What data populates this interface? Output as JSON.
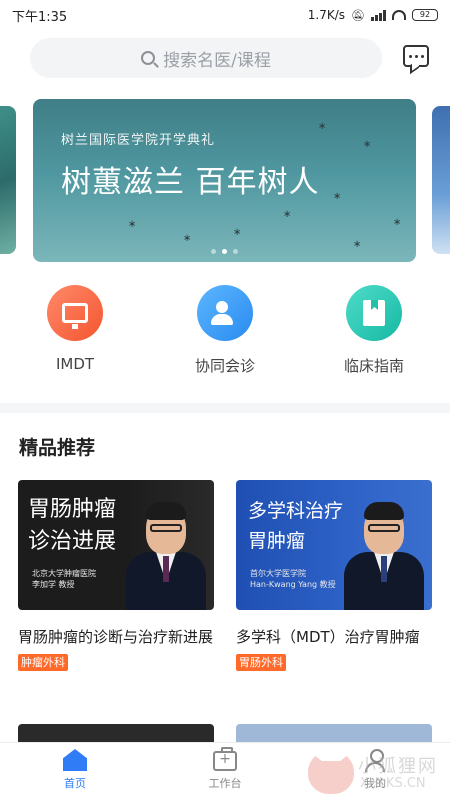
{
  "status_bar": {
    "time": "下午1:35",
    "speed": "1.7K/s",
    "battery": "92"
  },
  "search": {
    "placeholder": "搜索名医/课程"
  },
  "banner": {
    "subtitle": "树兰国际医学院开学典礼",
    "title": "树蕙滋兰 百年树人",
    "active_dot": 1,
    "dot_count": 3
  },
  "quick_entries": [
    {
      "label": "IMDT",
      "icon": "monitor-icon",
      "color": "#f4552f"
    },
    {
      "label": "协同会诊",
      "icon": "users-icon",
      "color": "#2a8bef"
    },
    {
      "label": "临床指南",
      "icon": "book-icon",
      "color": "#16b9a4"
    }
  ],
  "section": {
    "title": "精品推荐"
  },
  "cards": [
    {
      "thumb_line1": "胃肠肿瘤",
      "thumb_line2": "诊治进展",
      "thumb_small1": "北京大学肿瘤医院",
      "thumb_small2": "李加学 教授",
      "title": "胃肠肿瘤的诊断与治疗新进展",
      "tag": "肿瘤外科"
    },
    {
      "thumb_line1": "多学科治疗",
      "thumb_line2": "胃肿瘤",
      "thumb_small1": "首尔大学医学院",
      "thumb_small2": "Han-Kwang Yang 教授",
      "title": "多学科（MDT）治疗胃肿瘤",
      "tag": "胃肠外科"
    }
  ],
  "tabbar": [
    {
      "label": "首页",
      "icon": "home-icon",
      "active": true
    },
    {
      "label": "工作台",
      "icon": "briefcase-icon",
      "active": false
    },
    {
      "label": "我的",
      "icon": "person-icon",
      "active": false
    }
  ],
  "watermark": {
    "cn": "小狐狸网",
    "en": "XHLKS.CN"
  },
  "colors": {
    "accent": "#2f7cf6",
    "tag": "#ff6a2b"
  }
}
